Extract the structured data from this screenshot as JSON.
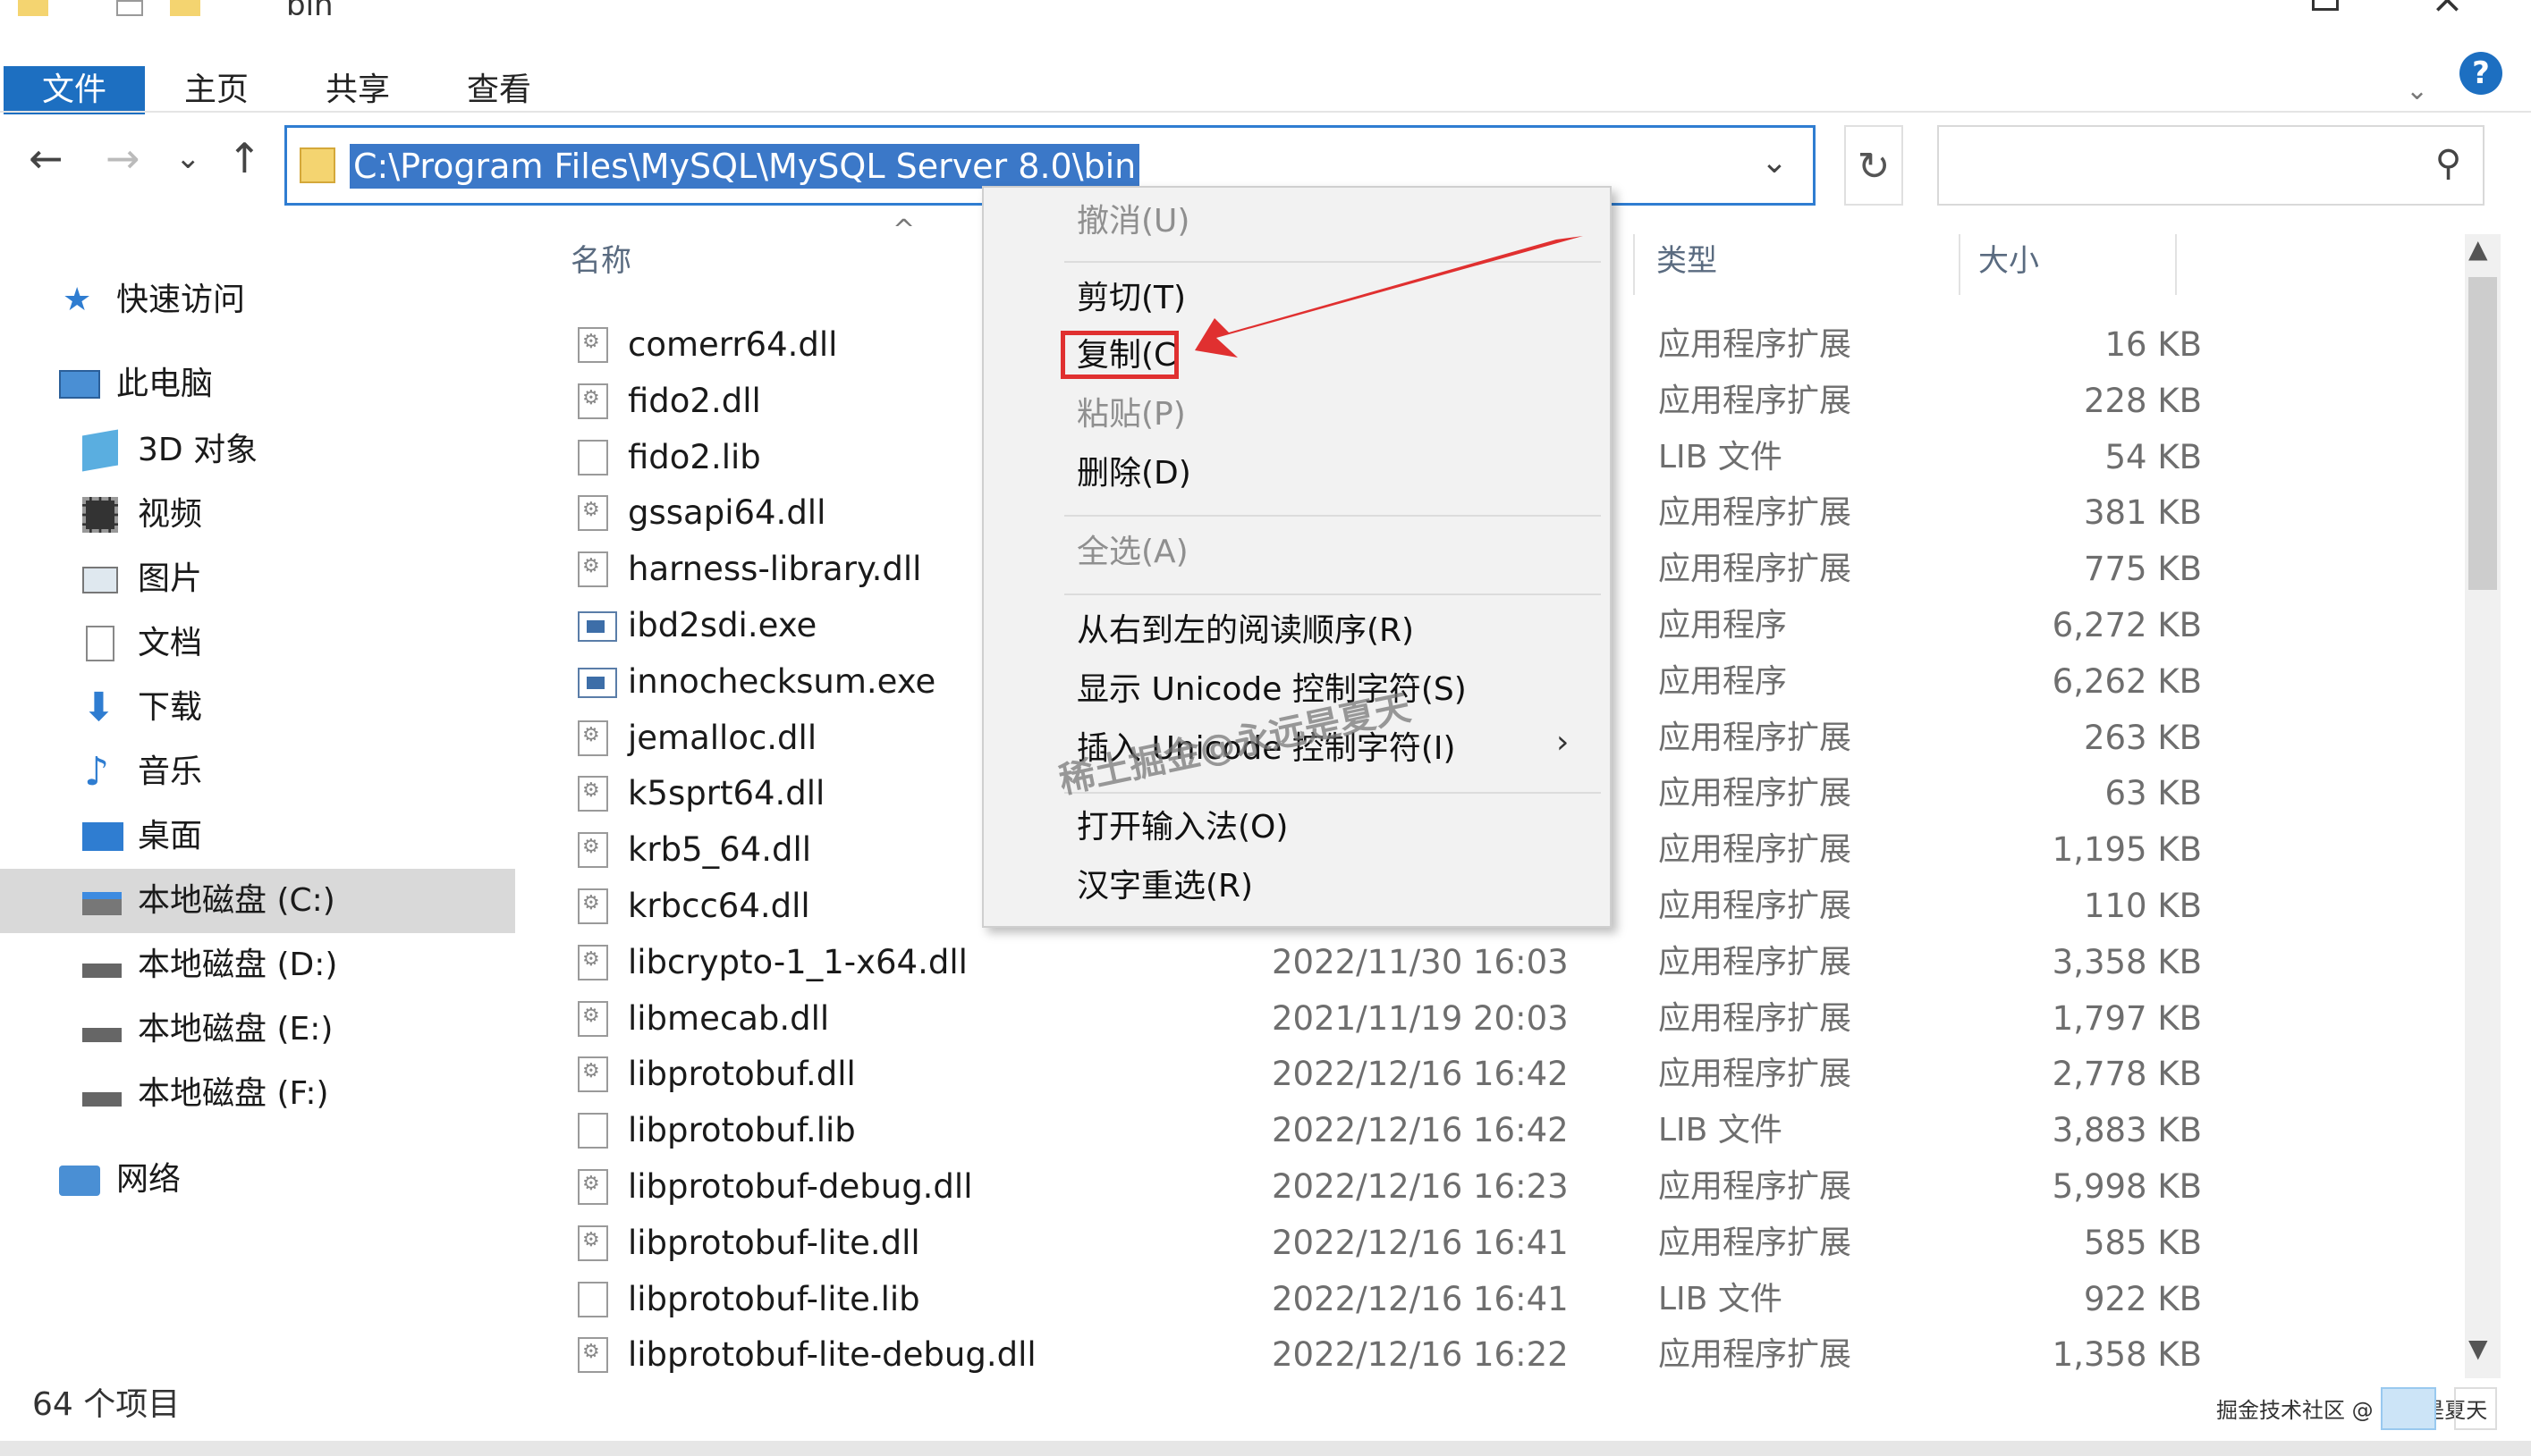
{
  "window": {
    "title": "bin"
  },
  "ribbon": {
    "tabs": [
      "文件",
      "主页",
      "共享",
      "查看"
    ],
    "help_icon": "?"
  },
  "nav": {
    "back_icon": "←",
    "forward_icon": "→",
    "recent_icon": "⌄",
    "up_icon": "↑",
    "address": "C:\\Program Files\\MySQL\\MySQL Server 8.0\\bin",
    "dropdown_icon": "⌄",
    "refresh_icon": "↻",
    "search_placeholder": "",
    "search_icon": "⚲"
  },
  "sidebar": {
    "items": [
      {
        "label": "快速访问",
        "icon": "star-pin-icon"
      },
      {
        "label": "此电脑",
        "icon": "computer-icon"
      },
      {
        "label": "3D 对象",
        "icon": "cube-icon"
      },
      {
        "label": "视频",
        "icon": "film-icon"
      },
      {
        "label": "图片",
        "icon": "picture-icon"
      },
      {
        "label": "文档",
        "icon": "document-icon"
      },
      {
        "label": "下载",
        "icon": "download-arrow-icon"
      },
      {
        "label": "音乐",
        "icon": "music-note-icon"
      },
      {
        "label": "桌面",
        "icon": "desktop-icon"
      },
      {
        "label": "本地磁盘 (C:)",
        "icon": "windows-drive-icon",
        "selected": true
      },
      {
        "label": "本地磁盘 (D:)",
        "icon": "drive-icon"
      },
      {
        "label": "本地磁盘 (E:)",
        "icon": "drive-icon"
      },
      {
        "label": "本地磁盘 (F:)",
        "icon": "drive-icon"
      },
      {
        "label": "网络",
        "icon": "network-icon"
      }
    ]
  },
  "columns": {
    "name": "名称",
    "type": "类型",
    "size": "大小",
    "sort_icon": "^"
  },
  "files": [
    {
      "name": "comerr64.dll",
      "date": "",
      "type": "应用程序扩展",
      "size": "16 KB",
      "kind": "dll"
    },
    {
      "name": "fido2.dll",
      "date": "",
      "type": "应用程序扩展",
      "size": "228 KB",
      "kind": "dll"
    },
    {
      "name": "fido2.lib",
      "date": "",
      "type": "LIB 文件",
      "size": "54 KB",
      "kind": "lib"
    },
    {
      "name": "gssapi64.dll",
      "date": "",
      "type": "应用程序扩展",
      "size": "381 KB",
      "kind": "dll"
    },
    {
      "name": "harness-library.dll",
      "date": "",
      "type": "应用程序扩展",
      "size": "775 KB",
      "kind": "dll"
    },
    {
      "name": "ibd2sdi.exe",
      "date": "",
      "type": "应用程序",
      "size": "6,272 KB",
      "kind": "exe"
    },
    {
      "name": "innochecksum.exe",
      "date": "",
      "type": "应用程序",
      "size": "6,262 KB",
      "kind": "exe"
    },
    {
      "name": "jemalloc.dll",
      "date": "",
      "type": "应用程序扩展",
      "size": "263 KB",
      "kind": "dll"
    },
    {
      "name": "k5sprt64.dll",
      "date": "",
      "type": "应用程序扩展",
      "size": "63 KB",
      "kind": "dll"
    },
    {
      "name": "krb5_64.dll",
      "date": "",
      "type": "应用程序扩展",
      "size": "1,195 KB",
      "kind": "dll"
    },
    {
      "name": "krbcc64.dll",
      "date": "",
      "type": "应用程序扩展",
      "size": "110 KB",
      "kind": "dll"
    },
    {
      "name": "libcrypto-1_1-x64.dll",
      "date": "2022/11/30 16:03",
      "type": "应用程序扩展",
      "size": "3,358 KB",
      "kind": "dll"
    },
    {
      "name": "libmecab.dll",
      "date": "2021/11/19 20:03",
      "type": "应用程序扩展",
      "size": "1,797 KB",
      "kind": "dll"
    },
    {
      "name": "libprotobuf.dll",
      "date": "2022/12/16 16:42",
      "type": "应用程序扩展",
      "size": "2,778 KB",
      "kind": "dll"
    },
    {
      "name": "libprotobuf.lib",
      "date": "2022/12/16 16:42",
      "type": "LIB 文件",
      "size": "3,883 KB",
      "kind": "lib"
    },
    {
      "name": "libprotobuf-debug.dll",
      "date": "2022/12/16 16:23",
      "type": "应用程序扩展",
      "size": "5,998 KB",
      "kind": "dll"
    },
    {
      "name": "libprotobuf-lite.dll",
      "date": "2022/12/16 16:41",
      "type": "应用程序扩展",
      "size": "585 KB",
      "kind": "dll"
    },
    {
      "name": "libprotobuf-lite.lib",
      "date": "2022/12/16 16:41",
      "type": "LIB 文件",
      "size": "922 KB",
      "kind": "lib"
    },
    {
      "name": "libprotobuf-lite-debug.dll",
      "date": "2022/12/16 16:22",
      "type": "应用程序扩展",
      "size": "1,358 KB",
      "kind": "dll"
    }
  ],
  "context_menu": {
    "items": [
      {
        "label": "撤消(U)",
        "disabled": true
      },
      {
        "label": "剪切(T)",
        "disabled": false
      },
      {
        "label": "复制(C",
        "disabled": false,
        "highlighted": true
      },
      {
        "label": "粘贴(P)",
        "disabled": true
      },
      {
        "label": "删除(D)",
        "disabled": false
      },
      {
        "label": "全选(A)",
        "disabled": true
      },
      {
        "label": "从右到左的阅读顺序(R)",
        "disabled": false
      },
      {
        "label": "显示 Unicode 控制字符(S)",
        "disabled": false
      },
      {
        "label": "插入 Unicode 控制字符(I)",
        "disabled": false,
        "submenu": true
      },
      {
        "label": "打开输入法(O)",
        "disabled": false
      },
      {
        "label": "汉字重选(R)",
        "disabled": false
      }
    ],
    "submenu_icon": "›",
    "highlight_color": "#e03030"
  },
  "watermark": "稀土掘金@永远是夏天",
  "status": {
    "item_count": "64 个项目",
    "credit": "掘金技术社区 @ 永远是夏天"
  },
  "colors": {
    "accent": "#1d6fc1",
    "selection": "#3b78c8",
    "annotation": "#e03030"
  }
}
